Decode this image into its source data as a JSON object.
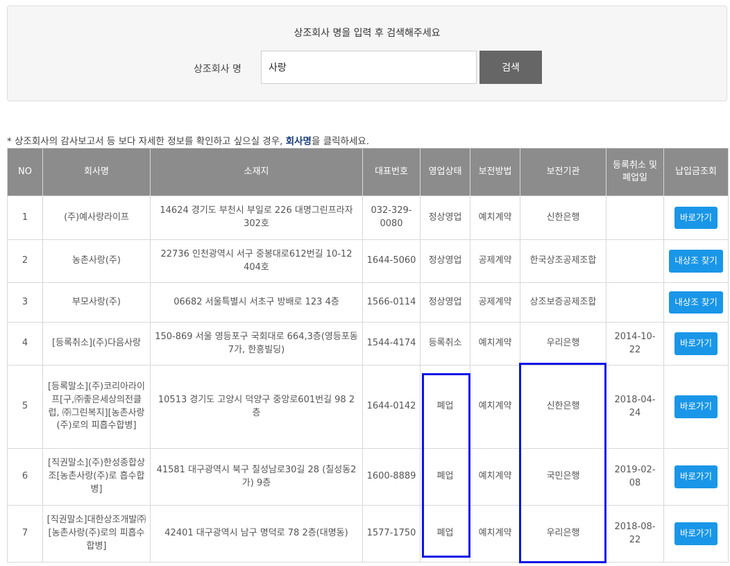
{
  "search": {
    "title": "상조회사 명을 입력 후 검색해주세요",
    "label": "상조회사 명",
    "value": "사랑",
    "button_label": "검색"
  },
  "notice": {
    "prefix": "* 상조회사의 감사보고서 등 보다 자세한 정보를 확인하고 싶으실 경우, ",
    "emphasis": "회사명",
    "suffix": "을 클릭하세요."
  },
  "table": {
    "headers": [
      "NO",
      "회사명",
      "소재지",
      "대표번호",
      "영업상태",
      "보전방법",
      "보전기관",
      "등록취소 및 폐업일",
      "납입금조회"
    ],
    "rows": [
      {
        "no": "1",
        "company": "(주)예사랑라이프",
        "address": "14624 경기도 부천시 부일로 226 대명그린프라자 302호",
        "phone": "032-329-0080",
        "status": "정상영업",
        "method": "예치계약",
        "institution": "신한은행",
        "cancel_date": "",
        "action": "바로가기"
      },
      {
        "no": "2",
        "company": "농촌사랑(주)",
        "address": "22736 인천광역시 서구 중봉대로612번길 10-12 404호",
        "phone": "1644-5060",
        "status": "정상영업",
        "method": "공제계약",
        "institution": "한국상조공제조합",
        "cancel_date": "",
        "action": "내상조 찾기"
      },
      {
        "no": "3",
        "company": "부모사랑(주)",
        "address": "06682 서울특별시 서초구 방배로 123 4층",
        "phone": "1566-0114",
        "status": "정상영업",
        "method": "공제계약",
        "institution": "상조보증공제조합",
        "cancel_date": "",
        "action": "내상조 찾기"
      },
      {
        "no": "4",
        "company": "[등록취소](주)다음사랑",
        "address": "150-869 서울 영등포구 국회대로 664,3층(영등포동7가, 한흥빌딩)",
        "phone": "1544-4174",
        "status": "등록취소",
        "method": "예치계약",
        "institution": "우리은행",
        "cancel_date": "2014-10-22",
        "action": "바로가기"
      },
      {
        "no": "5",
        "company": "[등록말소](주)코리아라이프[구,㈜좋은세상의전클럽, ㈜그린복지][농촌사랑(주)로의 피흡수합병]",
        "address": "10513 경기도 고양시 덕양구 중앙로601번길 98 2층",
        "phone": "1644-0142",
        "status": "폐업",
        "method": "예치계약",
        "institution": "신한은행",
        "cancel_date": "2018-04-24",
        "action": "바로가기"
      },
      {
        "no": "6",
        "company": "[직권말소](주)한성종합상조[농촌사랑(주)로 흡수합병]",
        "address": "41581 대구광역시 북구 칠성남로30길 28 (칠성동2가) 9층",
        "phone": "1600-8889",
        "status": "폐업",
        "method": "예치계약",
        "institution": "국민은행",
        "cancel_date": "2019-02-08",
        "action": "바로가기"
      },
      {
        "no": "7",
        "company": "[직권말소]대한상조개발㈜[농촌사랑(주)로의 피흡수합병]",
        "address": "42401 대구광역시 남구 명덕로 78 2층(대명동)",
        "phone": "1577-1750",
        "status": "폐업",
        "method": "예치계약",
        "institution": "우리은행",
        "cancel_date": "2018-08-22",
        "action": "바로가기"
      }
    ]
  },
  "colors": {
    "highlight": "#0a14e6",
    "button": "#1a96e8",
    "header_bg": "#8c8c8c",
    "accent_red": "#c00000",
    "link_blue": "#2a4a8e"
  }
}
